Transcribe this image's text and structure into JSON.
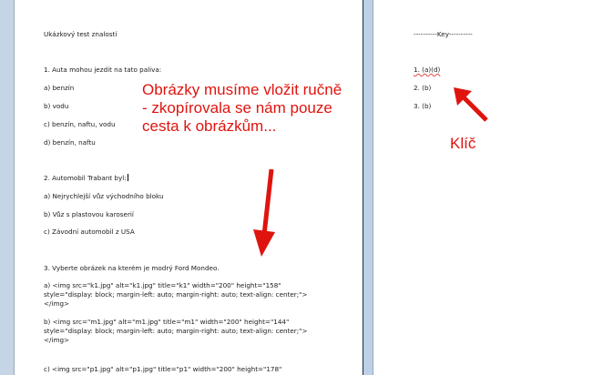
{
  "left_page": {
    "title": "Ukázkový test znalostí",
    "q1": {
      "question": "1. Auta mohou jezdit na tato paliva:",
      "options": [
        "a) benzín",
        "b) vodu",
        "c) benzín, naftu, vodu",
        "d) benzín, naftu"
      ]
    },
    "q2": {
      "question": "2. Automobil Trabant  byl:",
      "options": [
        "a) Nejrychlejší vůz východního bloku",
        "b) Vůz s plastovou karoserií",
        "c) Závodní automobil z USA"
      ]
    },
    "q3": {
      "question": "3. Vyberte obrázek na kterém je modrý Ford  Mondeo.",
      "options": [
        "a) <img src=\"k1.jpg\" alt=\"k1.jpg\" title=\"k1\" width=\"200\" height=\"158\" style=\"display: block; margin-left: auto; margin-right: auto; text-align: center;\"></img>",
        "b) <img src=\"m1.jpg\" alt=\"m1.jpg\" title=\"m1\" width=\"200\" height=\"144\" style=\"display: block; margin-left: auto; margin-right: auto; text-align: center;\"></img>",
        "c) <img src=\"p1.jpg\" alt=\"p1.jpg\" title=\"p1\" width=\"200\" height=\"178\""
      ]
    }
  },
  "right_page": {
    "key_header": "----------Key----------",
    "answers": [
      "1. (a)(d)",
      "2. (b)",
      "3. (b)"
    ]
  },
  "annotations": {
    "main_note": "Obrázky musíme vložit ručně\n- zkopírovala se nám pouze\ncesta k obrázkům...",
    "key_note": "Klíč",
    "color": "#e0140e"
  }
}
